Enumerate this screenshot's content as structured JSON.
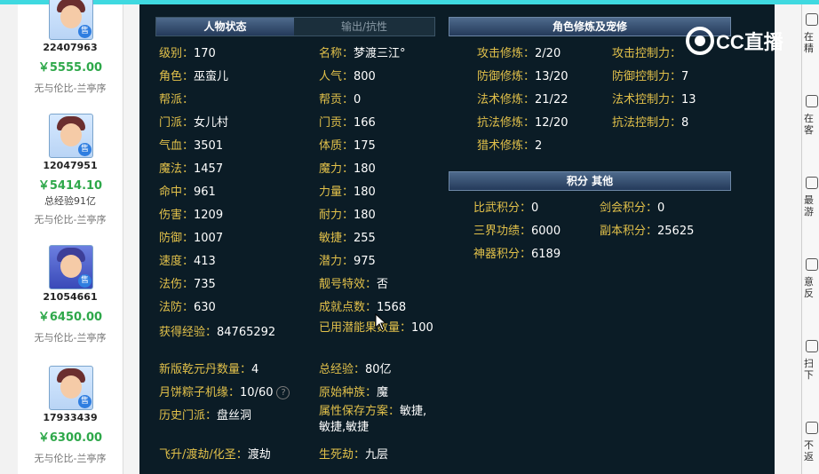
{
  "sellers": [
    {
      "id": "22407963",
      "price": "￥5555.00",
      "extra": "",
      "server": "无与伦比-兰亭序",
      "avatar": "female-hero"
    },
    {
      "id": "12047951",
      "price": "￥5414.10",
      "extra": "总经验91亿",
      "server": "无与伦比-兰亭序",
      "avatar": "female-hero"
    },
    {
      "id": "21054661",
      "price": "￥6450.00",
      "extra": "",
      "server": "无与伦比-兰亭序",
      "avatar": "blue-hero"
    },
    {
      "id": "17933439",
      "price": "￥6300.00",
      "extra": "",
      "server": "无与伦比-兰亭序",
      "avatar": "female-hero"
    }
  ],
  "sell_badge": "售",
  "tabs": {
    "active": "人物状态",
    "inactive": "输出/抗性"
  },
  "stats_left": [
    {
      "label": "级别：",
      "value": "170"
    },
    {
      "label": "角色：",
      "value": "巫蛮儿"
    },
    {
      "label": "帮派：",
      "value": ""
    },
    {
      "label": "门派：",
      "value": "女儿村"
    },
    {
      "label": "气血：",
      "value": "3501"
    },
    {
      "label": "魔法：",
      "value": "1457"
    },
    {
      "label": "命中：",
      "value": "961"
    },
    {
      "label": "伤害：",
      "value": "1209"
    },
    {
      "label": "防御：",
      "value": "1007"
    },
    {
      "label": "速度：",
      "value": "413"
    },
    {
      "label": "法伤：",
      "value": "735"
    },
    {
      "label": "法防：",
      "value": "630"
    },
    {
      "label": "获得经验：",
      "value": "84765292"
    },
    {
      "label": "新版乾元丹数量：",
      "value": "4"
    },
    {
      "label": "月饼粽子机缘：",
      "value": "10/60"
    },
    {
      "label": "历史门派：",
      "value": "盘丝洞"
    },
    {
      "label": "飞升/渡劫/化圣：",
      "value": "渡劫"
    }
  ],
  "stats_right": [
    {
      "label": "名称：",
      "value": "梦渡三江°"
    },
    {
      "label": "人气：",
      "value": "800"
    },
    {
      "label": "帮贡：",
      "value": "0"
    },
    {
      "label": "门贡：",
      "value": "166"
    },
    {
      "label": "体质：",
      "value": "175"
    },
    {
      "label": "魔力：",
      "value": "180"
    },
    {
      "label": "力量：",
      "value": "180"
    },
    {
      "label": "耐力：",
      "value": "180"
    },
    {
      "label": "敏捷：",
      "value": "255"
    },
    {
      "label": "潜力：",
      "value": "975"
    },
    {
      "label": "靓号特效：",
      "value": "否"
    },
    {
      "label": "成就点数：",
      "value": "1568"
    },
    {
      "label": "已用潜能果数量：",
      "value": "100"
    },
    {
      "label": "总经验：",
      "value": "80亿"
    },
    {
      "label": "原始种族：",
      "value": "魔"
    },
    {
      "label": "属性保存方案：",
      "value": "敏捷,敏捷,敏捷"
    },
    {
      "label": "生死劫：",
      "value": "九层"
    }
  ],
  "help_glyph": "?",
  "cultivation": {
    "title": "角色修炼及宠修",
    "rows": [
      {
        "label": "攻击修炼：",
        "value": "2/20",
        "label2": "攻击控制力：",
        "value2": ""
      },
      {
        "label": "防御修炼：",
        "value": "13/20",
        "label2": "防御控制力：",
        "value2": "7"
      },
      {
        "label": "法术修炼：",
        "value": "21/22",
        "label2": "法术控制力：",
        "value2": "13"
      },
      {
        "label": "抗法修炼：",
        "value": "12/20",
        "label2": "抗法控制力：",
        "value2": "8"
      },
      {
        "label": "猎术修炼：",
        "value": "2",
        "label2": "",
        "value2": ""
      }
    ]
  },
  "points": {
    "title": "积分 其他",
    "rows": [
      {
        "label": "比武积分：",
        "value": "0",
        "label2": "剑会积分：",
        "value2": "0"
      },
      {
        "label": "三界功绩：",
        "value": "6000",
        "label2": "副本积分：",
        "value2": "25625"
      },
      {
        "label": "神器积分：",
        "value": "6189",
        "label2": "",
        "value2": ""
      }
    ]
  },
  "logo": {
    "text": "CC直播"
  },
  "right_sidebar": [
    "在精",
    "在客",
    "最游",
    "意反",
    "扫下",
    "不返"
  ],
  "colors": {
    "label": "#e2c14a",
    "value": "#ffffff",
    "price": "#2ea84a",
    "panel": "#0b1c26",
    "accent": "#3fd9e0"
  }
}
